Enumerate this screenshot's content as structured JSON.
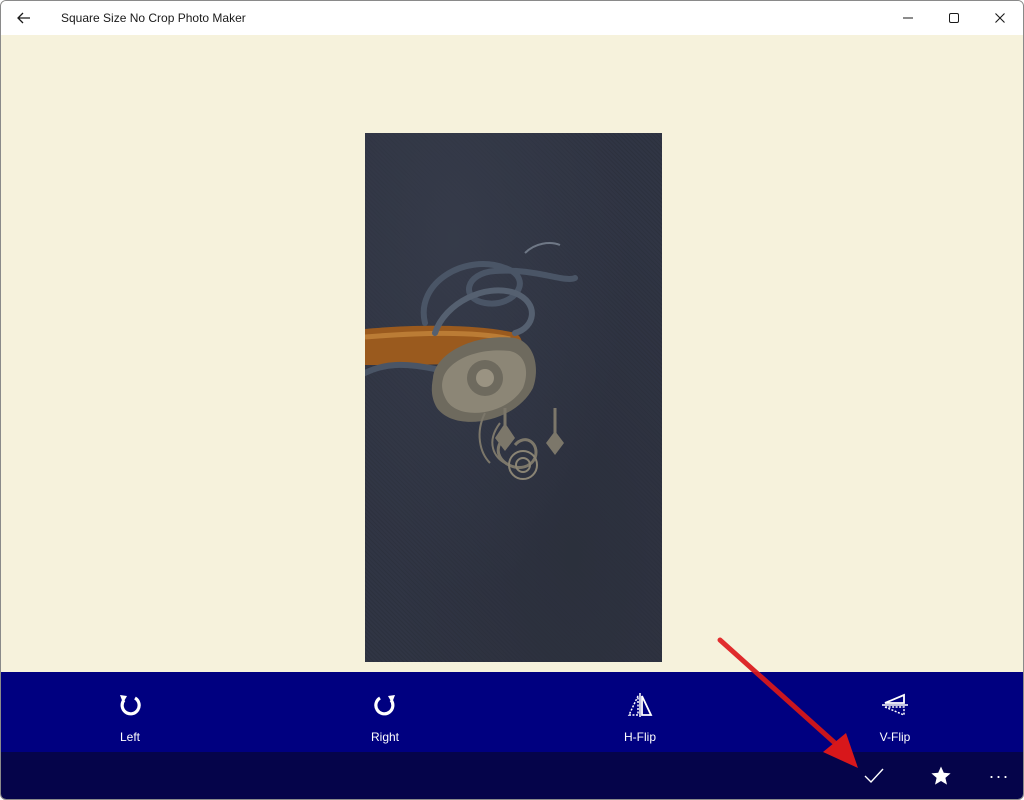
{
  "window": {
    "title": "Square Size No Crop Photo Maker",
    "back_icon": "back-arrow-icon",
    "caption_buttons": [
      "minimize-icon",
      "maximize-icon",
      "close-icon"
    ]
  },
  "canvas": {
    "background": "#f6f2dc",
    "photo": "photo of a silver pendant necklace on a dark navy fabric"
  },
  "toolbar": {
    "background": "#000080",
    "tools": [
      {
        "label": "Left",
        "icon": "rotate-left-icon"
      },
      {
        "label": "Right",
        "icon": "rotate-right-icon"
      },
      {
        "label": "H-Flip",
        "icon": "horizontal-flip-icon"
      },
      {
        "label": "V-Flip",
        "icon": "vertical-flip-icon"
      }
    ]
  },
  "command_bar": {
    "background": "#05044a",
    "buttons": [
      "checkmark-icon",
      "star-icon",
      "more-icon"
    ],
    "more_glyph": "···"
  },
  "annotation": {
    "color": "#e0191c",
    "points_to": "checkmark-icon"
  }
}
